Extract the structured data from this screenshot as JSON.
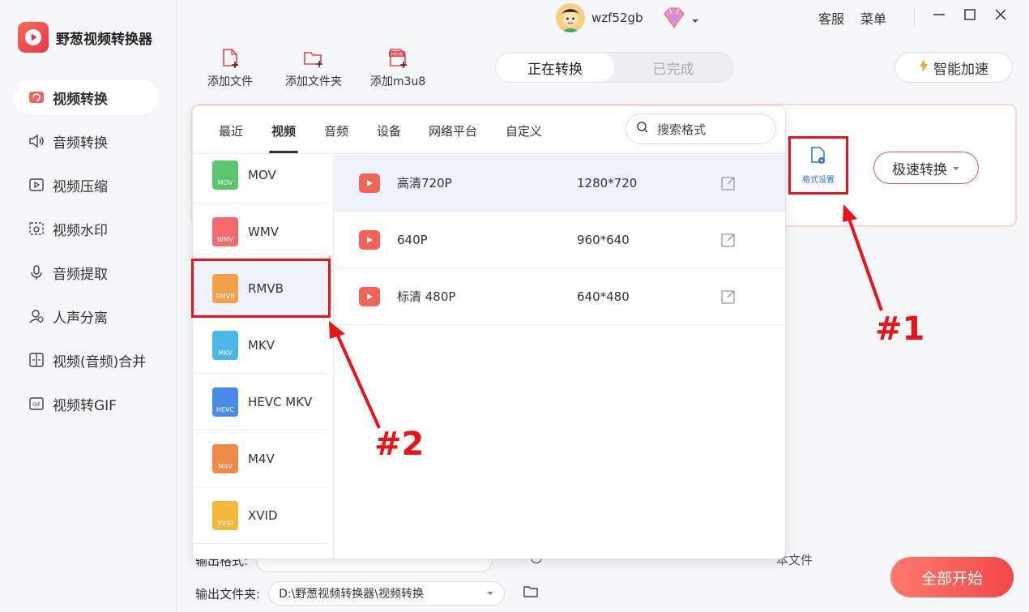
{
  "app": {
    "name": "野葱视频转换器"
  },
  "sidebar": {
    "items": [
      {
        "label": "视频转换",
        "icon": "video-convert-icon",
        "active": true
      },
      {
        "label": "音频转换",
        "icon": "audio-convert-icon"
      },
      {
        "label": "视频压缩",
        "icon": "video-compress-icon"
      },
      {
        "label": "视频水印",
        "icon": "video-watermark-icon"
      },
      {
        "label": "音频提取",
        "icon": "audio-extract-icon"
      },
      {
        "label": "人声分离",
        "icon": "voice-separate-icon"
      },
      {
        "label": "视频(音频)合并",
        "icon": "merge-icon"
      },
      {
        "label": "视频转GIF",
        "icon": "gif-icon"
      }
    ]
  },
  "topbar": {
    "username": "wzf52gb",
    "links": [
      "客服",
      "菜单"
    ]
  },
  "toolbar": {
    "add_file": "添加文件",
    "add_folder": "添加文件夹",
    "add_m3u8": "添加m3u8",
    "m3u8_badge": "M3U8",
    "tabs": [
      "正在转换",
      "已完成"
    ],
    "speed_label": "智能加速"
  },
  "task": {
    "format_setting_label": "格式设置",
    "fast_convert_label": "极速转换"
  },
  "popup": {
    "tabs": [
      "最近",
      "视频",
      "音频",
      "设备",
      "网络平台",
      "自定义"
    ],
    "active_tab": "视频",
    "search_placeholder": "搜索格式",
    "formats": [
      {
        "name": "MOV",
        "badge": "MOV",
        "color": "#5cc46b"
      },
      {
        "name": "WMV",
        "badge": "WMV",
        "color": "#f06b6b"
      },
      {
        "name": "RMVB",
        "badge": "RMVB",
        "color": "#f3a04a",
        "selected": true
      },
      {
        "name": "MKV",
        "badge": "MKV",
        "color": "#4cb6e8"
      },
      {
        "name": "HEVC MKV",
        "badge": "HEVC",
        "color": "#4a8ae8"
      },
      {
        "name": "M4V",
        "badge": "M4V",
        "color": "#f08a4a"
      },
      {
        "name": "XVID",
        "badge": "XVID",
        "color": "#f3b83a"
      }
    ],
    "presets": [
      {
        "name": "高清720P",
        "resolution": "1280*720"
      },
      {
        "name": "640P",
        "resolution": "960*640"
      },
      {
        "name": "标清 480P",
        "resolution": "640*480"
      }
    ]
  },
  "bottom": {
    "output_format_label": "输出格式:",
    "output_folder_label": "输出文件夹:",
    "output_folder_value": "D:\\野葱视频转换器\\视频转换",
    "hidden_text": "本文件",
    "start_all": "全部开始"
  },
  "annotations": {
    "label_1": "#1",
    "label_2": "#2",
    "color": "#e8141a"
  }
}
